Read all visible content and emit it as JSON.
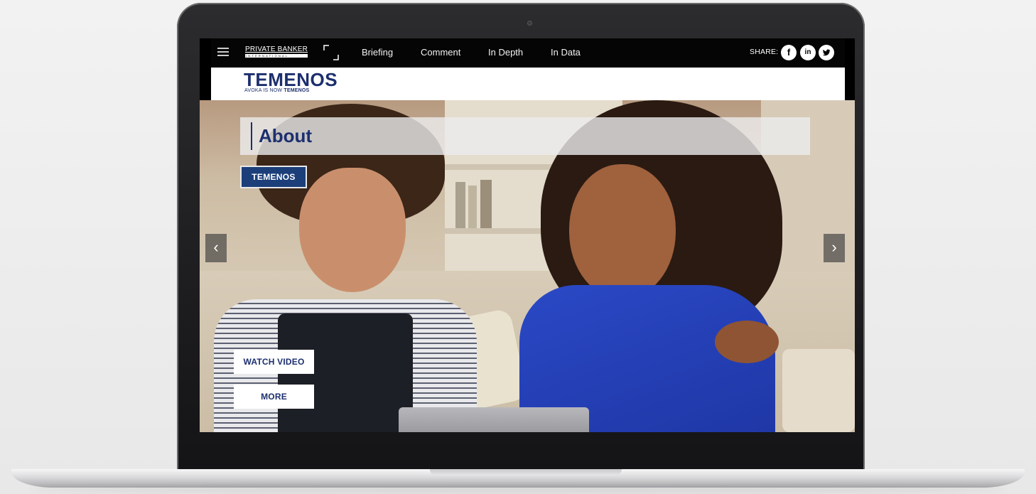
{
  "topbar": {
    "logo_line1": "PRIVATE BANKER",
    "logo_line2": "INTERNATIONAL",
    "nav": [
      "Briefing",
      "Comment",
      "In Depth",
      "In Data"
    ],
    "share_label": "SHARE:",
    "social": [
      {
        "icon": "facebook-icon",
        "glyph": "f"
      },
      {
        "icon": "linkedin-icon",
        "glyph": "in"
      },
      {
        "icon": "twitter-icon",
        "glyph": "t"
      }
    ]
  },
  "brand": {
    "logo": "TEMENOS",
    "tagline_prefix": "AVOKA IS NOW",
    "tagline_brand": "TEMENOS"
  },
  "hero": {
    "title": "About",
    "tag_label": "TEMENOS",
    "watch_video_label": "WATCH VIDEO",
    "more_label": "MORE",
    "prev_glyph": "‹",
    "next_glyph": "›"
  },
  "colors": {
    "brand_navy": "#1c2f6e",
    "tag_blue": "#1c3f7a",
    "topbar_bg": "#050505"
  }
}
